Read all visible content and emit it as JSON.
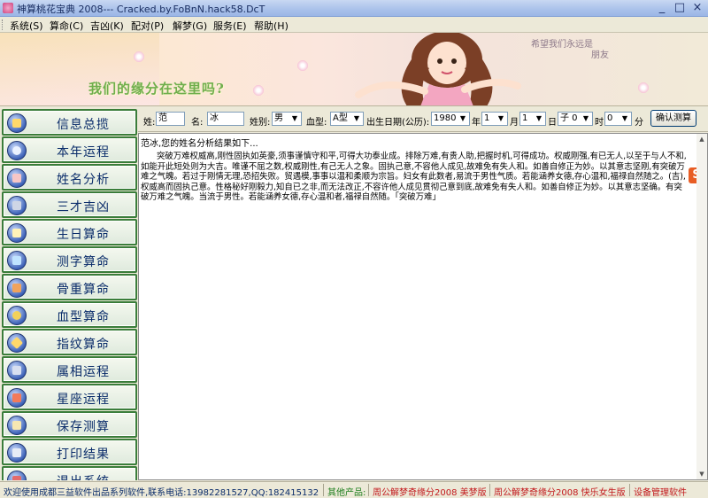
{
  "window": {
    "title": "神算桃花宝典 2008--- Cracked.by.FoBnN.hack58.DcT",
    "controls": [
      "_",
      "□",
      "×"
    ]
  },
  "menu": [
    {
      "label": "系统(S)"
    },
    {
      "label": "算命(C)"
    },
    {
      "label": "吉凶(K)"
    },
    {
      "label": "配对(P)"
    },
    {
      "label": "解梦(G)"
    },
    {
      "label": "服务(E)"
    },
    {
      "label": "帮助(H)"
    }
  ],
  "banner": {
    "slogan": "我们的缘分在这里吗?",
    "wish_line1": "希望我们永远是",
    "wish_line2": "朋友"
  },
  "sidebar": {
    "items": [
      {
        "label": "信息总揽",
        "icon": "info-icon"
      },
      {
        "label": "本年运程",
        "icon": "eye-icon"
      },
      {
        "label": "姓名分析",
        "icon": "name-icon"
      },
      {
        "label": "三才吉凶",
        "icon": "three-talents-icon"
      },
      {
        "label": "生日算命",
        "icon": "birthday-icon"
      },
      {
        "label": "测字算命",
        "icon": "character-icon"
      },
      {
        "label": "骨重算命",
        "icon": "bone-weight-icon"
      },
      {
        "label": "血型算命",
        "icon": "blood-type-icon"
      },
      {
        "label": "指纹算命",
        "icon": "fingerprint-icon"
      },
      {
        "label": "属相运程",
        "icon": "zodiac-animal-icon"
      },
      {
        "label": "星座运程",
        "icon": "constellation-icon"
      },
      {
        "label": "保存测算",
        "icon": "save-icon"
      },
      {
        "label": "打印结果",
        "icon": "print-icon"
      },
      {
        "label": "退出系统",
        "icon": "exit-icon"
      }
    ]
  },
  "form": {
    "surname_label": "姓:",
    "surname_value": "范",
    "given_label": "名:",
    "given_value": "冰",
    "gender_label": "姓别:",
    "gender_value": "男",
    "blood_label": "血型:",
    "blood_value": "A型",
    "birth_label": "出生日期(公历):",
    "year_value": "1980",
    "year_unit": "年",
    "month_value": "1",
    "month_unit": "月",
    "day_value": "1",
    "day_unit": "日",
    "hour_value": "子 0",
    "hour_unit": "时",
    "minute_value": "0",
    "minute_unit": "分",
    "confirm_label": "确认测算"
  },
  "result": {
    "heading": "范冰,您的姓名分析结果如下...",
    "text": "突破万难权威高,刚性固执如英豪,须事谨慎守和平,可得大功泰业成。排除万难,有贵人助,把握时机,可得成功。权威刚强,有已无人,以至于与人不和,如能开此短处则为大吉。唯谨不屈之数,权威刚性,有己无人之象。固执己意,不容他人成见,故难免有失人和。如善自修正为妙。以其意志坚刚,有突破万难之气魄。若过于刚情无理,恐招失败。贸遇模,事事以温和柔顺为宗旨。妇女有此数者,易流于男性气质。若能涵养女德,存心温和,福禄自然随之。(吉),权威高而固执己意。性格秘好刚毅力,知自已之非,而无法改正,不容许他人成见贯彻己意到底,故难免有失人和。如善自修正为妙。以其意志坚确。有突破万难之气魄。当流于男性。若能涵养女德,存心温和者,福禄自然随。「突破万难」"
  },
  "status": {
    "welcome": "欢迎使用成都三益软件出品系列软件,联系电话:13982281527,QQ:182415132",
    "other_products": "其他产品:",
    "product1": "周公解梦奇缘分2008 美梦版",
    "product2": "周公解梦奇缘分2008 快乐女生版",
    "product3": "设备管理软件"
  },
  "colors": {
    "accent_green": "#3a7d3a",
    "title_blue": "#1b2f62",
    "status_red": "#c2181c"
  }
}
